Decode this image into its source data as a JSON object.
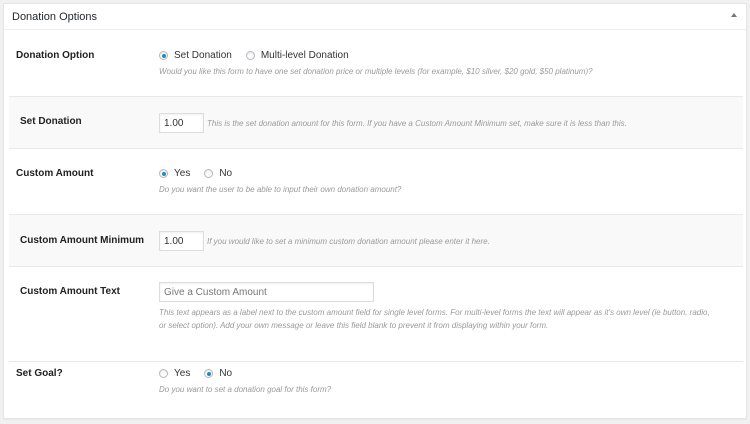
{
  "panel": {
    "title": "Donation Options"
  },
  "donation_option": {
    "label": "Donation Option",
    "options": [
      "Set Donation",
      "Multi-level Donation"
    ],
    "selected": "Set Donation",
    "description": "Would you like this form to have one set donation price or multiple levels (for example, $10 silver, $20 gold, $50 platinum)?"
  },
  "set_donation": {
    "label": "Set Donation",
    "value": "1.00",
    "description": "This is the set donation amount for this form. If you have a Custom Amount Minimum set, make sure it is less than this."
  },
  "custom_amount": {
    "label": "Custom Amount",
    "options": [
      "Yes",
      "No"
    ],
    "selected": "Yes",
    "description": "Do you want the user to be able to input their own donation amount?"
  },
  "custom_amount_minimum": {
    "label": "Custom Amount Minimum",
    "value": "1.00",
    "description": "If you would like to set a minimum custom donation amount please enter it here."
  },
  "custom_amount_text": {
    "label": "Custom Amount Text",
    "placeholder": "Give a Custom Amount",
    "description_lines": [
      "This text appears as a label next to the custom amount field for single level forms. For multi-level forms the text will appear as it's own level (ie button, radio,",
      "or select option). Add your own message or leave this field blank to prevent it from displaying within your form."
    ]
  },
  "set_goal": {
    "label": "Set Goal?",
    "options": [
      "Yes",
      "No"
    ],
    "selected": "No",
    "description": "Do you want to set a donation goal for this form?"
  }
}
